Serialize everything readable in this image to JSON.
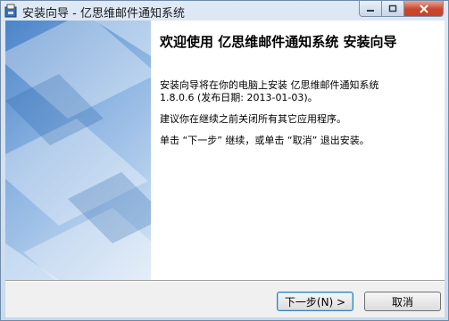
{
  "window": {
    "title": "安装向导 - 亿思维邮件通知系统"
  },
  "caption_buttons": [
    "minimize-icon",
    "maximize-icon",
    "close-icon"
  ],
  "main": {
    "heading": "欢迎使用 亿思维邮件通知系统 安装向导",
    "line1": "安装向导将在你的电脑上安装 亿思维邮件通知系统",
    "line2": "1.8.0.6 (发布日期: 2013-01-03)。",
    "line3": "建议你在继续之前关闭所有其它应用程序。",
    "line4": "单击 “下一步” 继续，或单击 “取消” 退出安装。"
  },
  "buttons": {
    "next_label": "下一步(N) >",
    "cancel_label": "取消"
  },
  "colors": {
    "accent": "#3c7fb1",
    "close": "#c8422a"
  }
}
